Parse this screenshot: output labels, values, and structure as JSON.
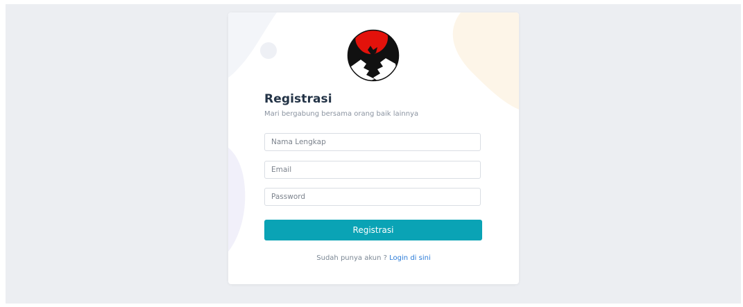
{
  "register": {
    "title": "Registrasi",
    "subtitle": "Mari bergabung bersama orang baik lainnya",
    "fields": {
      "full_name_placeholder": "Nama Lengkap",
      "email_placeholder": "Email",
      "password_placeholder": "Password"
    },
    "submit_label": "Registrasi",
    "login_prompt": "Sudah punya akun ?",
    "login_link": "Login di sini"
  },
  "colors": {
    "page_background": "#eceef2",
    "button": "#0aa3b5",
    "link": "#2a7bd8",
    "title": "#243447",
    "logo_red": "#e3120b"
  },
  "icons": {
    "logo": "helping-hands-logo"
  }
}
